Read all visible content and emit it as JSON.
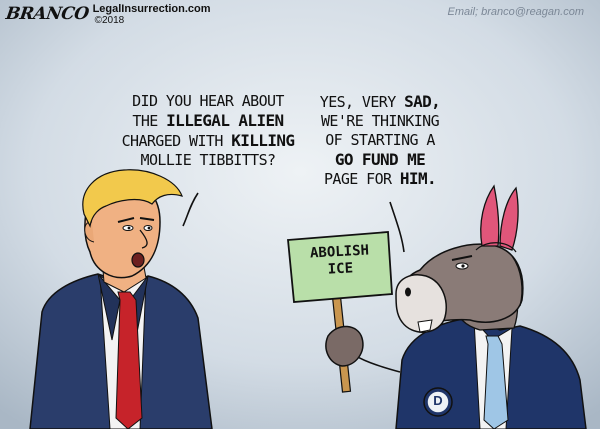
{
  "header": {
    "artist": "BRANCO",
    "site": "LegalInsurrection.com",
    "year": "©2018",
    "email": "Email; branco@reagan.com"
  },
  "speech": {
    "left": {
      "line1": "DID YOU HEAR ABOUT",
      "line2_pre": "THE ",
      "line2_bold": "ILLEGAL ALIEN",
      "line3_pre": "CHARGED WITH ",
      "line3_bold": "KILLING",
      "line4": "MOLLIE TIBBITTS?"
    },
    "right": {
      "line1_pre": "YES, VERY ",
      "line1_bold": "SAD,",
      "line2": "WE'RE THINKING",
      "line3": "OF STARTING A",
      "line4": "GO FUND ME",
      "line5_pre": "PAGE FOR ",
      "line5_bold": "HIM."
    }
  },
  "sign": {
    "line1": "ABOLISH",
    "line2": "ICE"
  },
  "pin_letter": "D",
  "colors": {
    "sky": "#c9d4df",
    "suit": "#2a3d6b",
    "tie": "#c6232a",
    "hair": "#f2c94c",
    "sign": "#b9dfa9",
    "hat": "#e0567a"
  }
}
